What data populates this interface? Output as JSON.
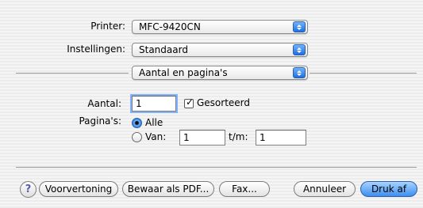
{
  "printer": {
    "label": "Printer:",
    "value": "MFC-9420CN"
  },
  "presets": {
    "label": "Instellingen:",
    "value": "Standaard"
  },
  "section_popup": {
    "value": "Aantal en pagina's"
  },
  "copies": {
    "label": "Aantal:",
    "value": "1",
    "collated_label": "Gesorteerd",
    "collated_checked": true
  },
  "pages": {
    "label": "Pagina's:",
    "all_label": "Alle",
    "from_label": "Van:",
    "from_value": "1",
    "to_label": "t/m:",
    "to_value": "1",
    "selected": "all"
  },
  "buttons": {
    "help": "?",
    "preview": "Voorvertoning",
    "save_pdf": "Bewaar als PDF...",
    "fax": "Fax...",
    "cancel": "Annuleer",
    "print": "Druk af"
  },
  "colors": {
    "accent": "#3f8ef0"
  }
}
